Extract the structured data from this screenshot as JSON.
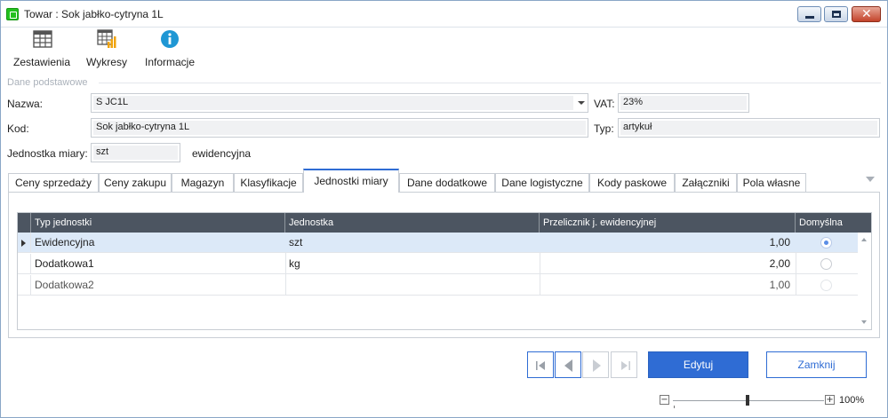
{
  "window": {
    "title": "Towar : Sok jabłko-cytryna 1L",
    "accent": "#2f6cd4"
  },
  "toolbar": {
    "items": [
      {
        "label": "Zestawienia",
        "icon": "table-icon"
      },
      {
        "label": "Wykresy",
        "icon": "chart-table-icon"
      },
      {
        "label": "Informacje",
        "icon": "info-icon"
      }
    ]
  },
  "section": {
    "legend": "Dane podstawowe"
  },
  "form": {
    "nazwa_label": "Nazwa:",
    "nazwa_value": "S JC1L",
    "vat_label": "VAT:",
    "vat_value": "23%",
    "kod_label": "Kod:",
    "kod_value": "Sok jabłko-cytryna 1L",
    "typ_label": "Typ:",
    "typ_value": "artykuł",
    "jm_label": "Jednostka miary:",
    "jm_value": "szt",
    "jm_suffix": "ewidencyjna"
  },
  "tabs": [
    {
      "label": "Ceny sprzedaży",
      "active": false
    },
    {
      "label": "Ceny zakupu",
      "active": false
    },
    {
      "label": "Magazyn",
      "active": false
    },
    {
      "label": "Klasyfikacje",
      "active": false
    },
    {
      "label": "Jednostki miary",
      "active": true
    },
    {
      "label": "Dane dodatkowe",
      "active": false
    },
    {
      "label": "Dane logistyczne",
      "active": false
    },
    {
      "label": "Kody paskowe",
      "active": false
    },
    {
      "label": "Załączniki",
      "active": false
    },
    {
      "label": "Pola własne",
      "active": false
    }
  ],
  "grid": {
    "columns": [
      "Typ jednostki",
      "Jednostka",
      "Przelicznik j. ewidencyjnej",
      "Domyślna"
    ],
    "rows": [
      {
        "typ": "Ewidencyjna",
        "jednostka": "szt",
        "przelicznik": "1,00",
        "domyslna": true
      },
      {
        "typ": "Dodatkowa1",
        "jednostka": "kg",
        "przelicznik": "2,00",
        "domyslna": false
      },
      {
        "typ": "Dodatkowa2",
        "jednostka": "",
        "przelicznik": "1,00",
        "domyslna": false
      }
    ]
  },
  "actions": {
    "edit_label": "Edytuj",
    "close_label": "Zamknij"
  },
  "zoom": {
    "minus": "−",
    "plus": "+",
    "value": "100%"
  }
}
